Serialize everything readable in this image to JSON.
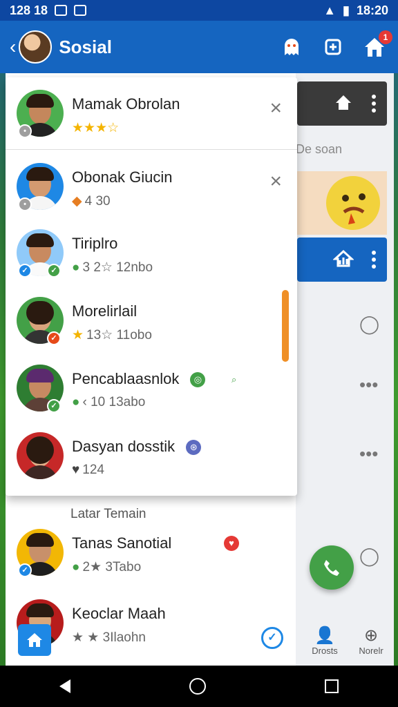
{
  "status": {
    "time_left": "128 18",
    "time_right": "18:20"
  },
  "appbar": {
    "back": "‹",
    "title": "Sosial",
    "notif_count": "1"
  },
  "popup": {
    "rows": [
      {
        "name": "Mamak Obrolan",
        "meta": "★★★☆",
        "close": "×"
      },
      {
        "name": "Obonak Giucin",
        "meta": "4 30",
        "close": "×"
      },
      {
        "name": "Tiriplro",
        "meta": "3 2☆ 12nbo"
      },
      {
        "name": "Morelirlail",
        "meta": "13☆ 11obo"
      },
      {
        "name": "Pencablaasnlok",
        "meta": "‹ 10  13abo"
      },
      {
        "name": "Dasyan dosstik",
        "meta": "124"
      }
    ]
  },
  "list": {
    "section_label": "Latar Temain",
    "rows": [
      {
        "name": "Tanas Sanotial",
        "meta": "2★ 3Tabo"
      },
      {
        "name": "Keoclar Maah",
        "meta": "★ ★ 3Ilaohn"
      }
    ]
  },
  "right_panel": {
    "text": "De soan",
    "tabs": [
      {
        "label": "Drosts"
      },
      {
        "label": "Norelr"
      }
    ]
  },
  "colors": {
    "primary": "#1565c0",
    "accent": "#43a047",
    "scrollbar": "#ef8f26"
  }
}
